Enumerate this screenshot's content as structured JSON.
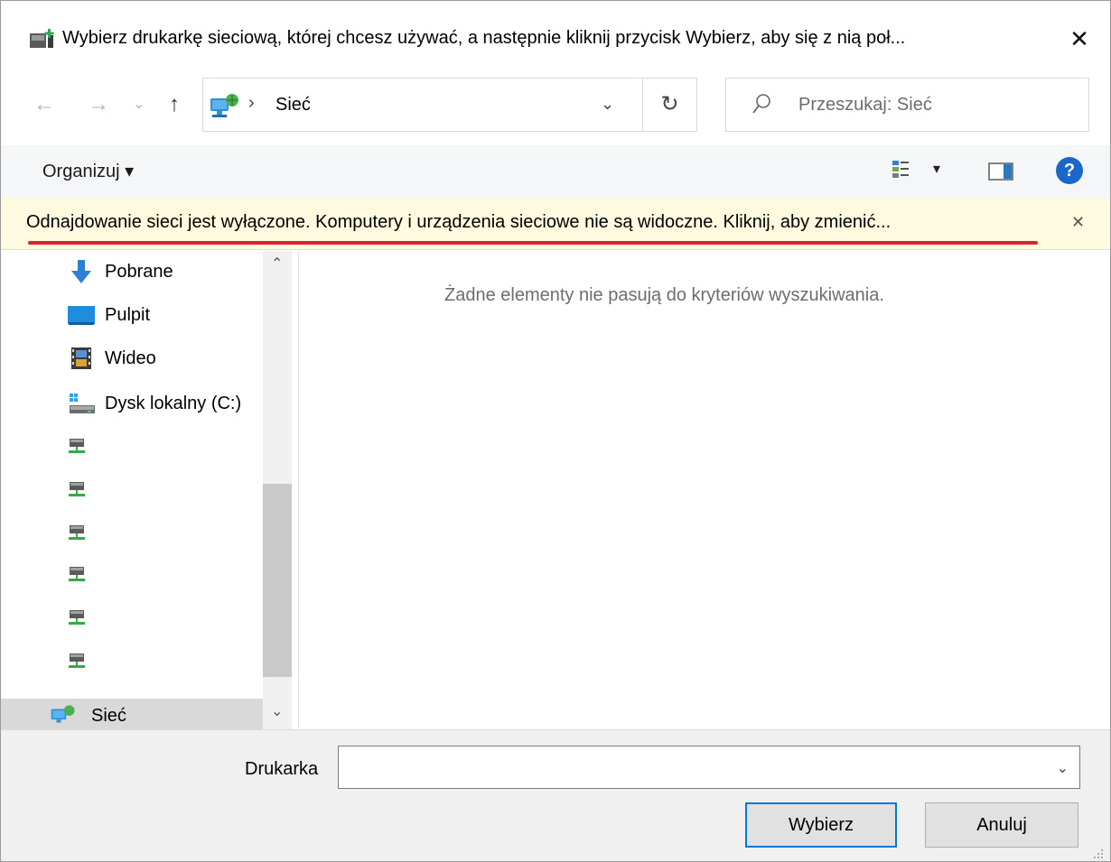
{
  "window": {
    "title": "Wybierz drukarkę sieciową, której chcesz używać, a następnie kliknij przycisk Wybierz, aby się z nią poł...",
    "close_glyph": "✕"
  },
  "navigation": {
    "back_glyph": "←",
    "forward_glyph": "→",
    "recent_glyph": "⌄",
    "up_glyph": "↑",
    "address_separator": "›",
    "address_location": "Sieć",
    "address_dropdown_glyph": "⌄",
    "refresh_glyph": "↻",
    "search_placeholder": "Przeszukaj: Sieć"
  },
  "toolbar": {
    "organize_label": "Organizuj ▾",
    "view_caret": "▾",
    "help_label": "?"
  },
  "infobar": {
    "message": "Odnajdowanie sieci jest wyłączone. Komputery i urządzenia sieciowe nie są widoczne. Kliknij, aby zmienić...",
    "close_glyph": "✕",
    "highlight_color": "#e0202a"
  },
  "sidebar": {
    "items": [
      {
        "label": "Pobrane",
        "icon": "download-arrow-icon"
      },
      {
        "label": "Pulpit",
        "icon": "desktop-icon"
      },
      {
        "label": "Wideo",
        "icon": "film-icon"
      },
      {
        "label": "Dysk lokalny (C:)",
        "icon": "local-disk-icon"
      },
      {
        "label": "",
        "icon": "network-drive-icon"
      },
      {
        "label": "",
        "icon": "network-drive-icon"
      },
      {
        "label": "",
        "icon": "network-drive-icon"
      },
      {
        "label": "",
        "icon": "network-drive-icon"
      },
      {
        "label": "",
        "icon": "network-drive-icon"
      },
      {
        "label": "",
        "icon": "network-drive-icon"
      },
      {
        "label": "Sieć",
        "icon": "network-icon",
        "selected": true
      }
    ],
    "scroll_up_glyph": "⌃",
    "scroll_down_glyph": "⌄"
  },
  "content": {
    "empty_message": "Żadne elementy nie pasują do kryteriów wyszukiwania."
  },
  "footer": {
    "printer_label": "Drukarka",
    "printer_value": "",
    "printer_dropdown_glyph": "⌄",
    "select_button": "Wybierz",
    "cancel_button": "Anuluj"
  },
  "colors": {
    "accent": "#0078d7",
    "infobar_background": "#fdfadf",
    "help_icon": "#1a67c9"
  }
}
